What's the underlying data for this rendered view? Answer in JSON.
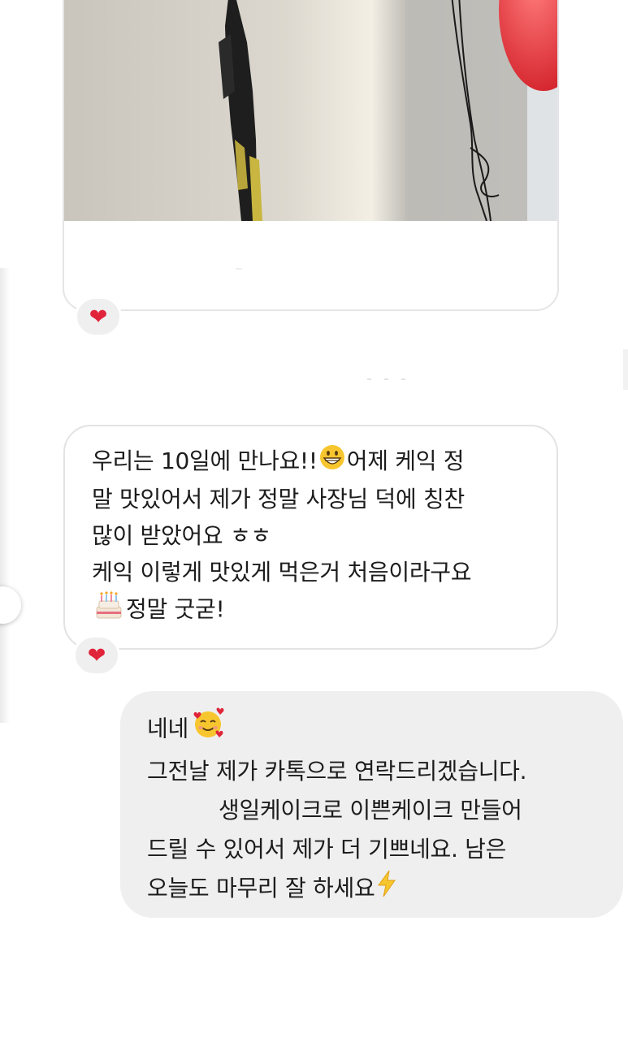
{
  "messages": {
    "photo_message": {
      "reaction": "❤"
    },
    "received_text": {
      "lines": [
        "우리는 10일에 만나요!!",
        "어제 케익 정",
        "말 맛있어서 제가 정말 사장님 덕에 칭찬",
        "많이 받았어요 ㅎㅎ",
        "케익 이렇게 맛있게 먹은거 처음이라구요",
        "정말 굿굳!"
      ],
      "emoji_1": "grinning-face-icon",
      "emoji_2": "birthday-cake-icon",
      "reaction": "❤"
    },
    "sent_text": {
      "lines": [
        "네네",
        "그전날 제가 카톡으로 연락드리겠습니다.",
        "생일케이크로 이쁜케이크 만들어",
        "드릴 수 있어서 제가 더 기쁘네요. 남은",
        "오늘도 마무리 잘 하세요"
      ],
      "emoji_1": "smiling-face-with-hearts-icon",
      "emoji_2": "lightning-icon"
    }
  },
  "colors": {
    "background": "#ffffff",
    "received_bubble_border": "#e3e3e6",
    "sent_bubble_bg": "#efefef",
    "heart": "#e0243a"
  }
}
